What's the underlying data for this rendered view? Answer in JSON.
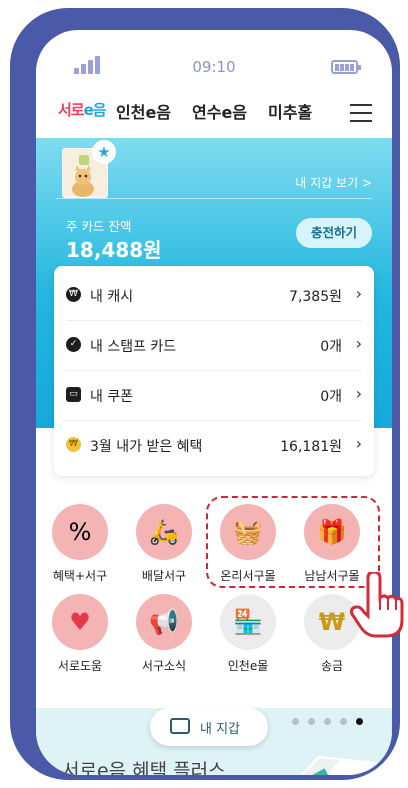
{
  "status": {
    "time": "09:10"
  },
  "nav": {
    "logo_part1": "서로",
    "logo_part2": "e음",
    "tabs": [
      "인천e음",
      "연수e음",
      "미추홀"
    ]
  },
  "wallet": {
    "view_link": "내 지갑 보기 >",
    "balance_label": "주 카드 잔액",
    "balance_value": "18,488원",
    "charge_button": "충전하기"
  },
  "summary": [
    {
      "icon": "won-icon",
      "label": "내 캐시",
      "value": "7,385원"
    },
    {
      "icon": "stamp-icon",
      "label": "내 스탬프 카드",
      "value": "0개"
    },
    {
      "icon": "coupon-icon",
      "label": "내 쿠폰",
      "value": "0개"
    },
    {
      "icon": "benefit-icon",
      "label": "3월 내가 받은 혜택",
      "value": "16,181원"
    }
  ],
  "services": [
    {
      "label": "혜택+서구",
      "icon": "benefit-plus-icon",
      "glyph": "%"
    },
    {
      "label": "배달서구",
      "icon": "delivery-scooter-icon",
      "glyph": "🛵"
    },
    {
      "label": "온리서구몰",
      "icon": "shopping-basket-icon",
      "glyph": "🧺"
    },
    {
      "label": "남남서구몰",
      "icon": "gift-cart-icon",
      "glyph": "🎁"
    },
    {
      "label": "서로도움",
      "icon": "helping-hand-icon",
      "glyph": "♥"
    },
    {
      "label": "서구소식",
      "icon": "news-megaphone-icon",
      "glyph": "📢"
    },
    {
      "label": "인천e몰",
      "icon": "storefront-icon",
      "glyph": "🏪"
    },
    {
      "label": "송금",
      "icon": "transfer-coin-icon",
      "glyph": "₩"
    }
  ],
  "bottom": {
    "my_wallet_button": "내 지갑",
    "promo_text": "서로e음 혜택 플러스",
    "page_count": 5,
    "active_page": 5
  },
  "colors": {
    "accent": "#22b6e0",
    "frame": "#4a5aa8",
    "highlight": "#cf2636",
    "icon_circle": "#f4b4b4"
  }
}
